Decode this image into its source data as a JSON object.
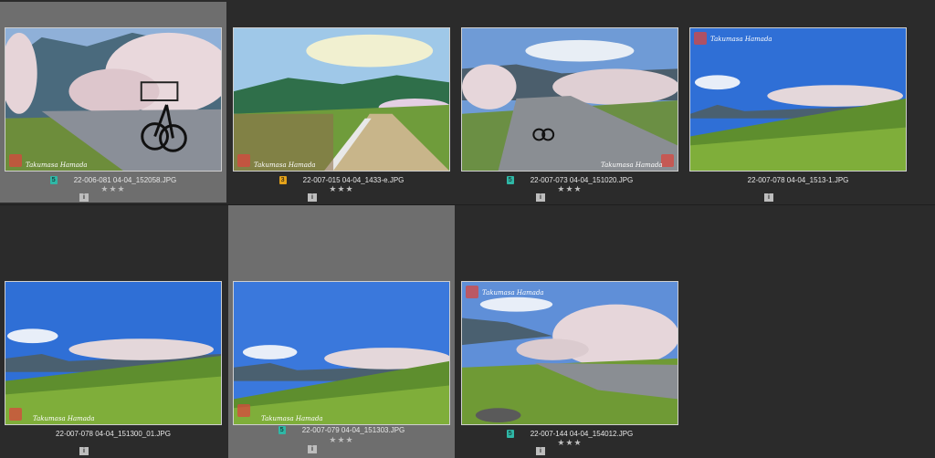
{
  "grid": {
    "cells": [
      {
        "filename": "22-006-081 04-04_152058.JPG",
        "label": "5",
        "label_color": "teal",
        "stars": "★★★",
        "info_icon": "info-icon",
        "selected": true
      },
      {
        "filename": "22-007-015 04-04_1433-e.JPG",
        "label": "3",
        "label_color": "amber",
        "stars": "★★★",
        "info_icon": "info-icon",
        "selected": false
      },
      {
        "filename": "22-007-073 04-04_151020.JPG",
        "label": "5",
        "label_color": "teal",
        "stars": "★★★",
        "info_icon": "info-icon",
        "selected": false
      },
      {
        "filename": "22-007-078 04-04_1513-1.JPG",
        "label": "",
        "label_color": "",
        "stars": "",
        "info_icon": "info-icon",
        "selected": false
      },
      {
        "filename": "22-007-078 04-04_151300_01.JPG",
        "label": "",
        "label_color": "",
        "stars": "",
        "info_icon": "info-icon",
        "selected": false
      },
      {
        "filename": "22-007-079 04-04_151303.JPG",
        "label": "5",
        "label_color": "teal",
        "stars": "★★★",
        "info_icon": "info-icon",
        "selected": true
      },
      {
        "filename": "22-007-144 04-04_154012.JPG",
        "label": "5",
        "label_color": "teal",
        "stars": "★★★",
        "info_icon": "info-icon",
        "selected": false
      }
    ],
    "watermark": "Takumasa Hamada",
    "info_glyph": "i"
  }
}
